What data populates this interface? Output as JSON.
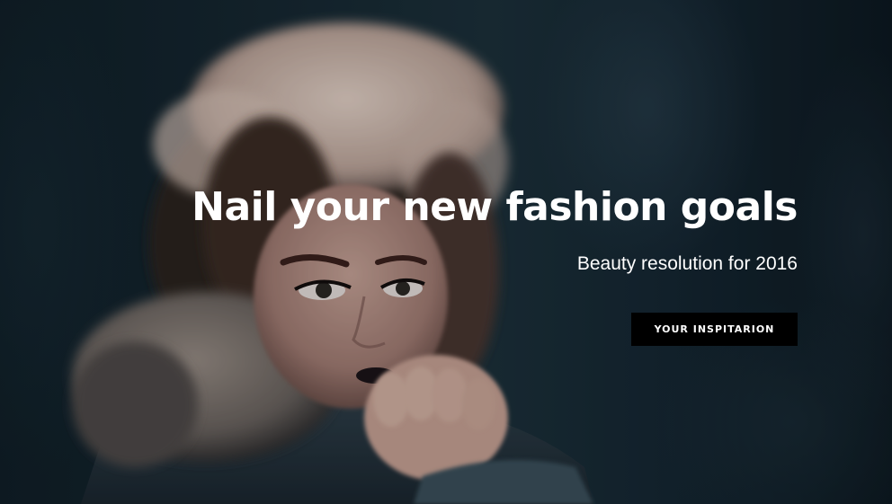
{
  "hero": {
    "headline": "Nail your new fashion goals",
    "subheadline": "Beauty resolution for 2016",
    "cta_label": "YOUR INSPITARION"
  },
  "colors": {
    "background": "#15262f",
    "text": "#ffffff",
    "button_bg": "#000000"
  }
}
